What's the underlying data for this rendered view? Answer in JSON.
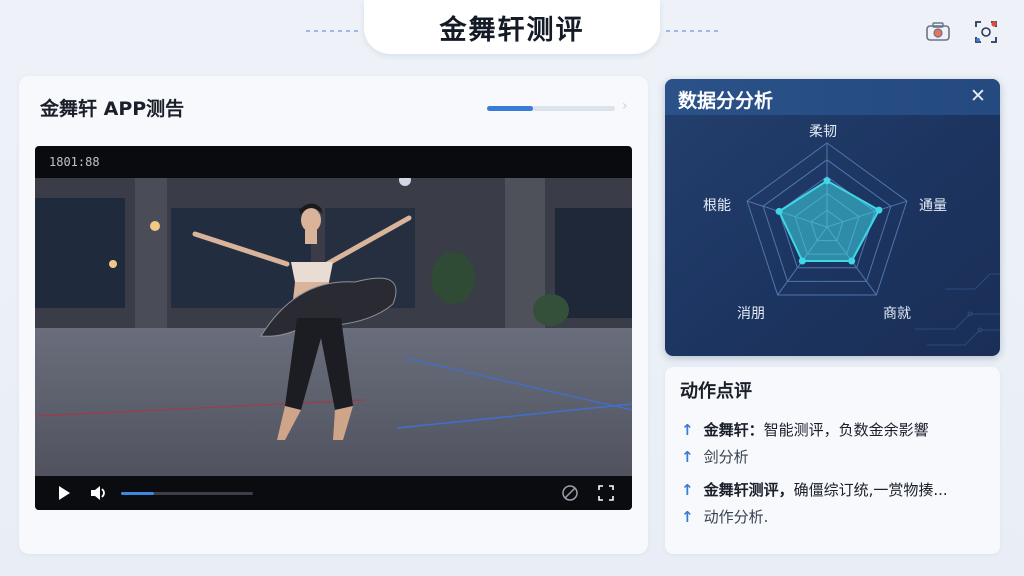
{
  "header": {
    "title": "金舞轩测评"
  },
  "left_panel": {
    "title": "金舞轩 APP测告",
    "load_progress": 0.36,
    "video": {
      "timecode": "1801:88",
      "seek_progress": 0.25
    }
  },
  "data_panel": {
    "title": "数据分分析",
    "close_label": "✕",
    "radar": {
      "axes": [
        "柔韧",
        "通量",
        "商就",
        "消朋",
        "根能"
      ],
      "values": [
        0.55,
        0.65,
        0.5,
        0.5,
        0.6
      ],
      "fill_color": "#3fd6e6"
    }
  },
  "review_panel": {
    "title": "动作点评",
    "items": [
      {
        "arrow": "↑",
        "bold": "金舞轩：",
        "text": "智能测评，负数金余影響"
      },
      {
        "arrow": "↑",
        "bold": "",
        "text": "剑分析"
      },
      {
        "arrow": "↑",
        "bold": "金舞轩测评，",
        "text": "确僵综订统,一赏物揍..."
      },
      {
        "arrow": "↑",
        "bold": "",
        "text": "动作分析."
      }
    ]
  },
  "colors": {
    "accent": "#3a7bd5",
    "panel_dark": "#1c3460"
  }
}
